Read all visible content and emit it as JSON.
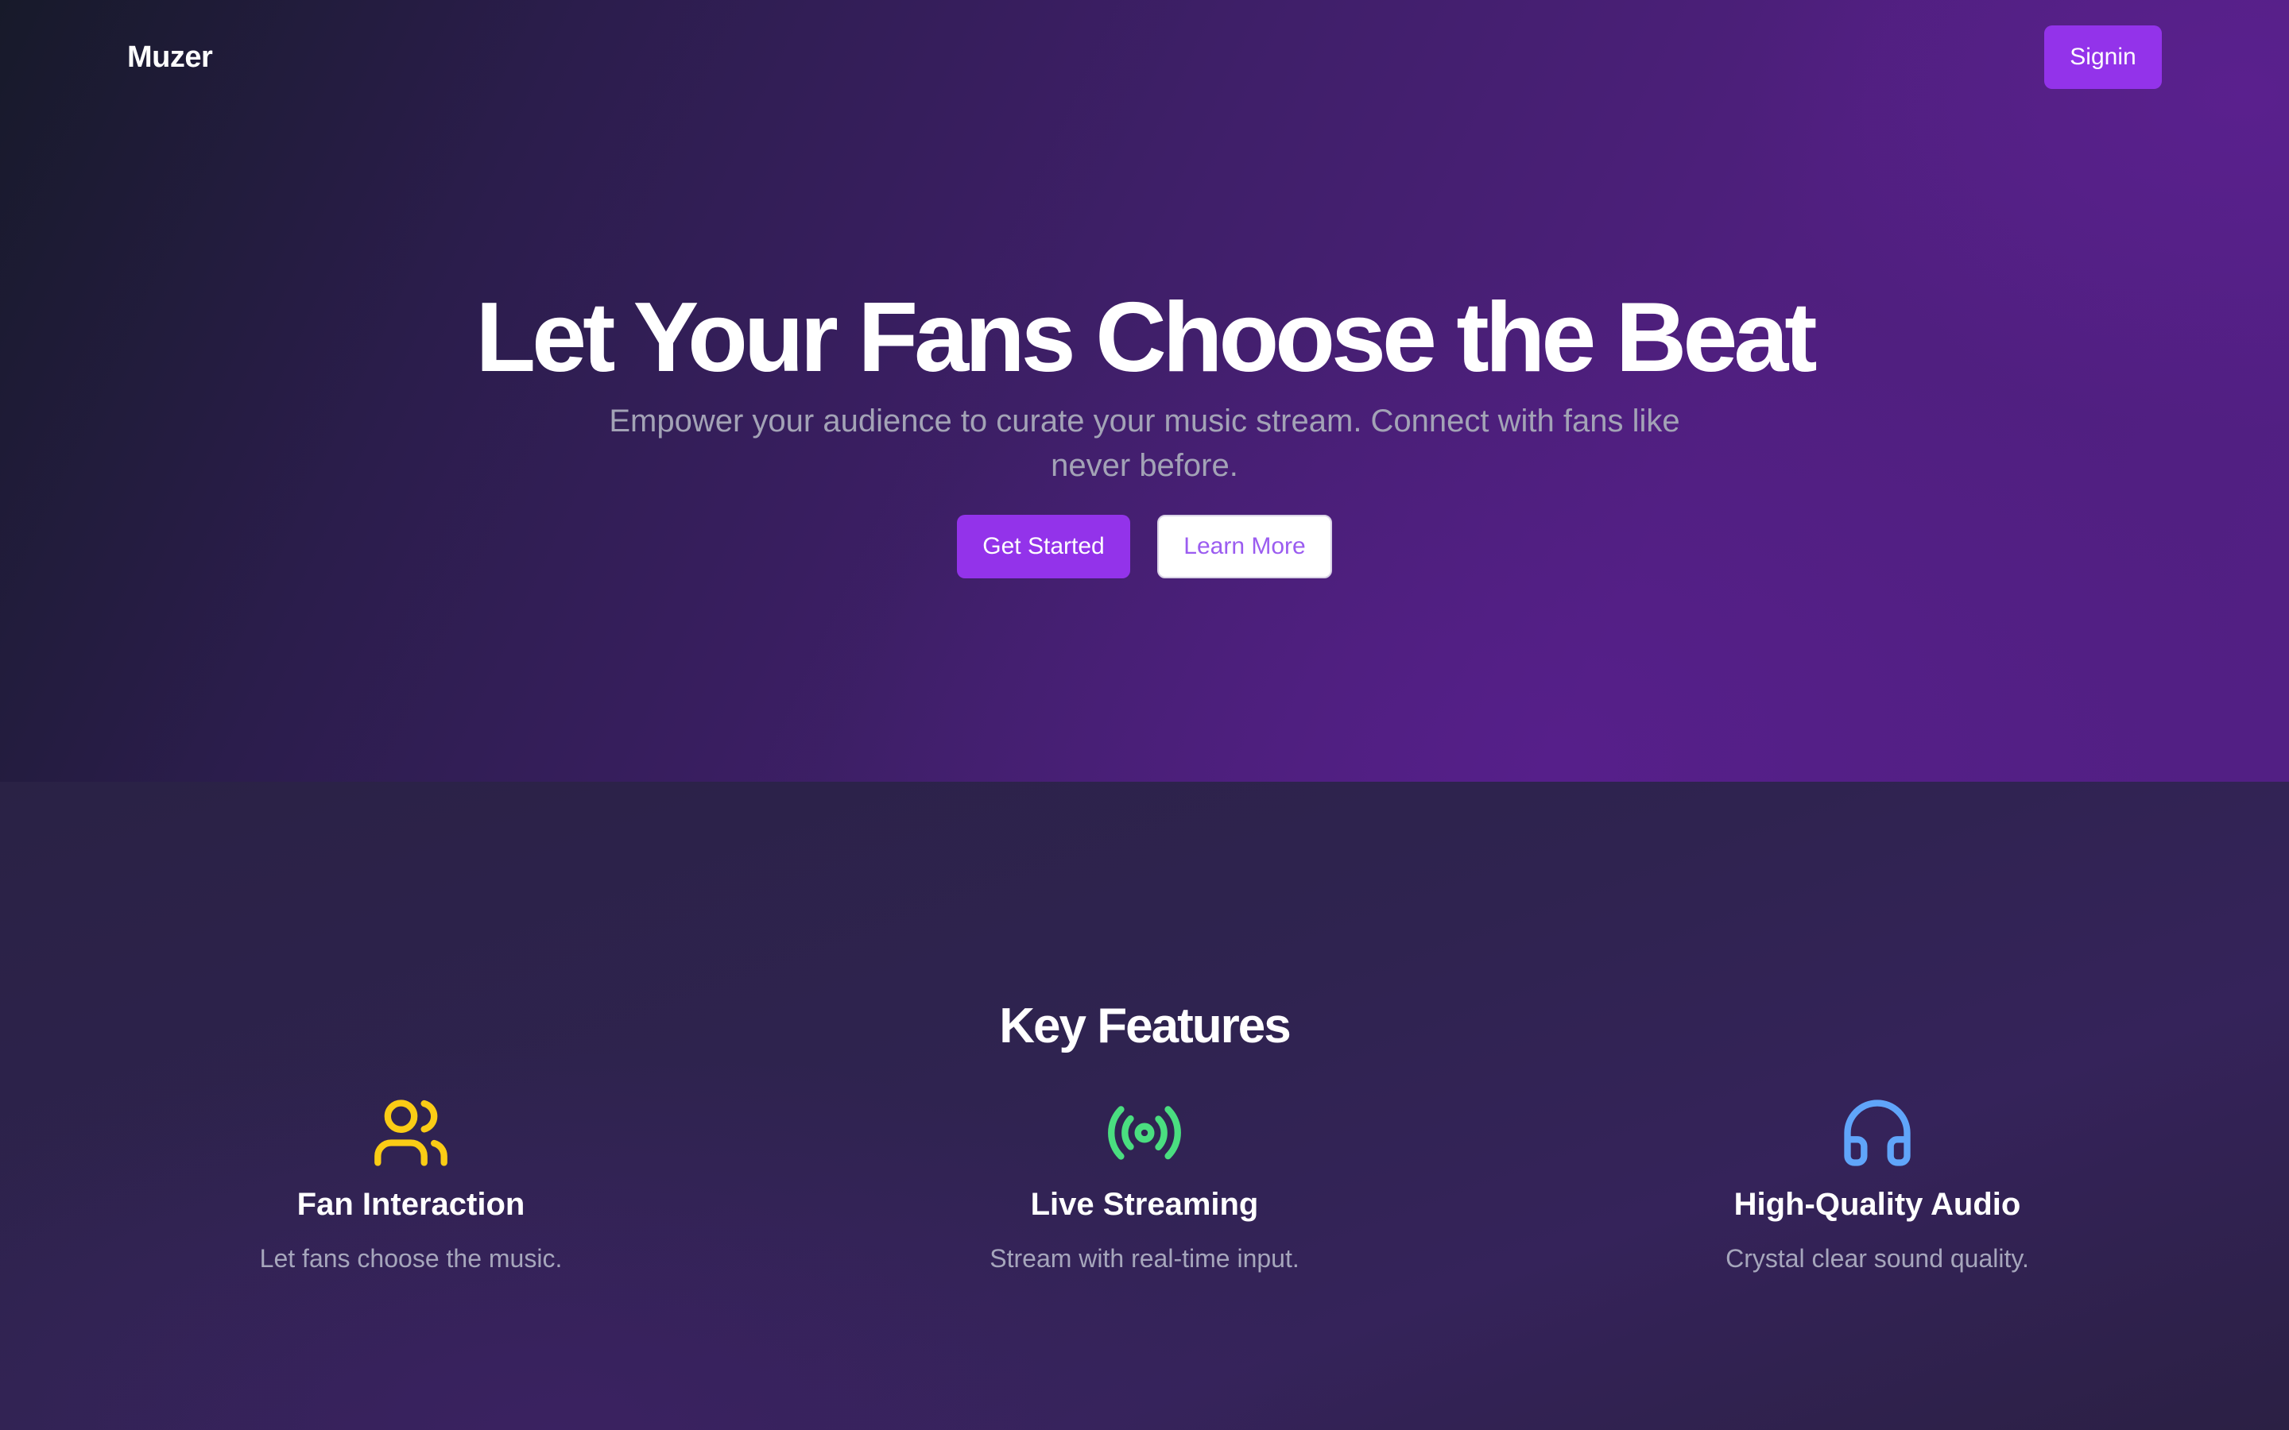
{
  "header": {
    "logo": "Muzer",
    "signin_label": "Signin"
  },
  "hero": {
    "title": "Let Your Fans Choose the Beat",
    "subtitle": "Empower your audience to curate your music stream. Connect with fans like never before.",
    "primary_cta": "Get Started",
    "secondary_cta": "Learn More"
  },
  "features": {
    "title": "Key Features",
    "items": [
      {
        "icon": "users-icon",
        "icon_color": "#facc15",
        "title": "Fan Interaction",
        "description": "Let fans choose the music."
      },
      {
        "icon": "radio-broadcast-icon",
        "icon_color": "#4ade80",
        "title": "Live Streaming",
        "description": "Stream with real-time input."
      },
      {
        "icon": "headphones-icon",
        "icon_color": "#60a5fa",
        "title": "High-Quality Audio",
        "description": "Crystal clear sound quality."
      }
    ]
  },
  "colors": {
    "accent": "#9333ea",
    "hero_gradient_start": "#171a2a",
    "hero_gradient_end": "#521f84",
    "features_bg": "#2f2350"
  }
}
